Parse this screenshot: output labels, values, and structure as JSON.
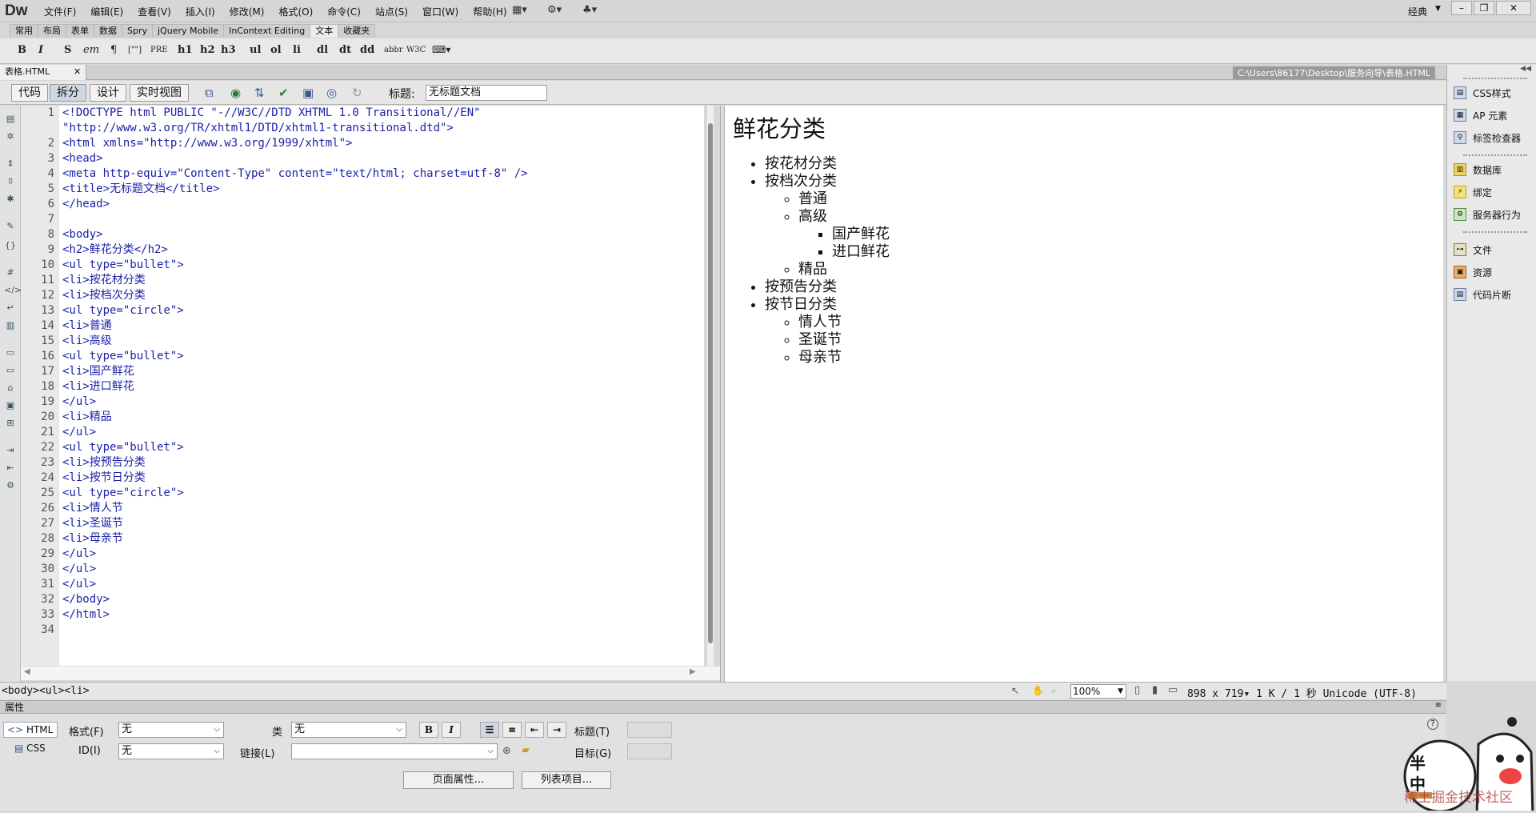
{
  "app": {
    "logo": "Dw",
    "workspace": "经典"
  },
  "menus": [
    "文件(F)",
    "编辑(E)",
    "查看(V)",
    "插入(I)",
    "修改(M)",
    "格式(O)",
    "命令(C)",
    "站点(S)",
    "窗口(W)",
    "帮助(H)"
  ],
  "insert_tabs": [
    "常用",
    "布局",
    "表单",
    "数据",
    "Spry",
    "jQuery Mobile",
    "InContext Editing",
    "文本",
    "收藏夹"
  ],
  "insert_active": "文本",
  "format_buttons": [
    "B",
    "I",
    "S",
    "em",
    "¶",
    "[\"\"]",
    "PRE",
    "h1",
    "h2",
    "h3",
    "ul",
    "ol",
    "li",
    "dl",
    "dt",
    "dd",
    "abbr",
    "W3C"
  ],
  "document": {
    "tab": "表格.HTML",
    "path": "C:\\Users\\86177\\Desktop\\服务向导\\表格.HTML"
  },
  "view_buttons": [
    "代码",
    "拆分",
    "设计",
    "实时视图"
  ],
  "view_active": "拆分",
  "title_label": "标题:",
  "title_value": "无标题文档",
  "line_numbers": [
    "1",
    "",
    "2",
    "3",
    "4",
    "5",
    "6",
    "7",
    "8",
    "9",
    "10",
    "11",
    "12",
    "13",
    "14",
    "15",
    "16",
    "17",
    "18",
    "19",
    "20",
    "21",
    "22",
    "23",
    "24",
    "25",
    "26",
    "27",
    "28",
    "29",
    "30",
    "31",
    "32",
    "33",
    "34"
  ],
  "code_lines": [
    "<!DOCTYPE html PUBLIC \"-//W3C//DTD XHTML 1.0 Transitional//EN\"",
    "\"http://www.w3.org/TR/xhtml1/DTD/xhtml1-transitional.dtd\">",
    "<html xmlns=\"http://www.w3.org/1999/xhtml\">",
    "<head>",
    "<meta http-equiv=\"Content-Type\" content=\"text/html; charset=utf-8\" />",
    "<title>无标题文档</title>",
    "</head>",
    "",
    "<body>",
    "<h2>鲜花分类</h2>",
    "<ul type=\"bullet\">",
    "<li>按花材分类",
    "<li>按档次分类",
    "<ul type=\"circle\">",
    "<li>普通",
    "<li>高级",
    "<ul type=\"bullet\">",
    "<li>国产鲜花",
    "<li>进口鲜花",
    "</ul>",
    "<li>精品",
    "</ul>",
    "<ul type=\"bullet\">",
    "<li>按预告分类",
    "<li>按节日分类",
    "<ul type=\"circle\">",
    "<li>情人节",
    "<li>圣诞节",
    "<li>母亲节",
    "</ul>",
    "</ul>",
    "</ul>",
    "</body>",
    "</html>",
    ""
  ],
  "design": {
    "heading": "鲜花分类",
    "items": {
      "a": "按花材分类",
      "b": "按档次分类",
      "b1": "普通",
      "b2": "高级",
      "b2a": "国产鲜花",
      "b2b": "进口鲜花",
      "b3": "精品",
      "c": "按预告分类",
      "d": "按节日分类",
      "d1": "情人节",
      "d2": "圣诞节",
      "d3": "母亲节"
    }
  },
  "status": {
    "tag_selector": "<body><ul><li>",
    "zoom": "100%",
    "size": "898 x 719",
    "download": "1 K / 1 秒",
    "encoding": "Unicode (UTF-8)"
  },
  "right_panel": [
    "CSS样式",
    "AP 元素",
    "标签检查器",
    "数据库",
    "绑定",
    "服务器行为",
    "文件",
    "资源",
    "代码片断"
  ],
  "properties": {
    "title": "属性",
    "html_tab": "HTML",
    "css_tab": "CSS",
    "format_label": "格式(F)",
    "format_value": "无",
    "id_label": "ID(I)",
    "id_value": "无",
    "class_label": "类",
    "class_value": "无",
    "link_label": "链接(L)",
    "title_label": "标题(T)",
    "target_label": "目标(G)",
    "page_props_btn": "页面属性...",
    "list_item_btn": "列表项目..."
  },
  "watermark": "稀土掘金技术社区",
  "mascot_text": [
    "半",
    "中"
  ]
}
